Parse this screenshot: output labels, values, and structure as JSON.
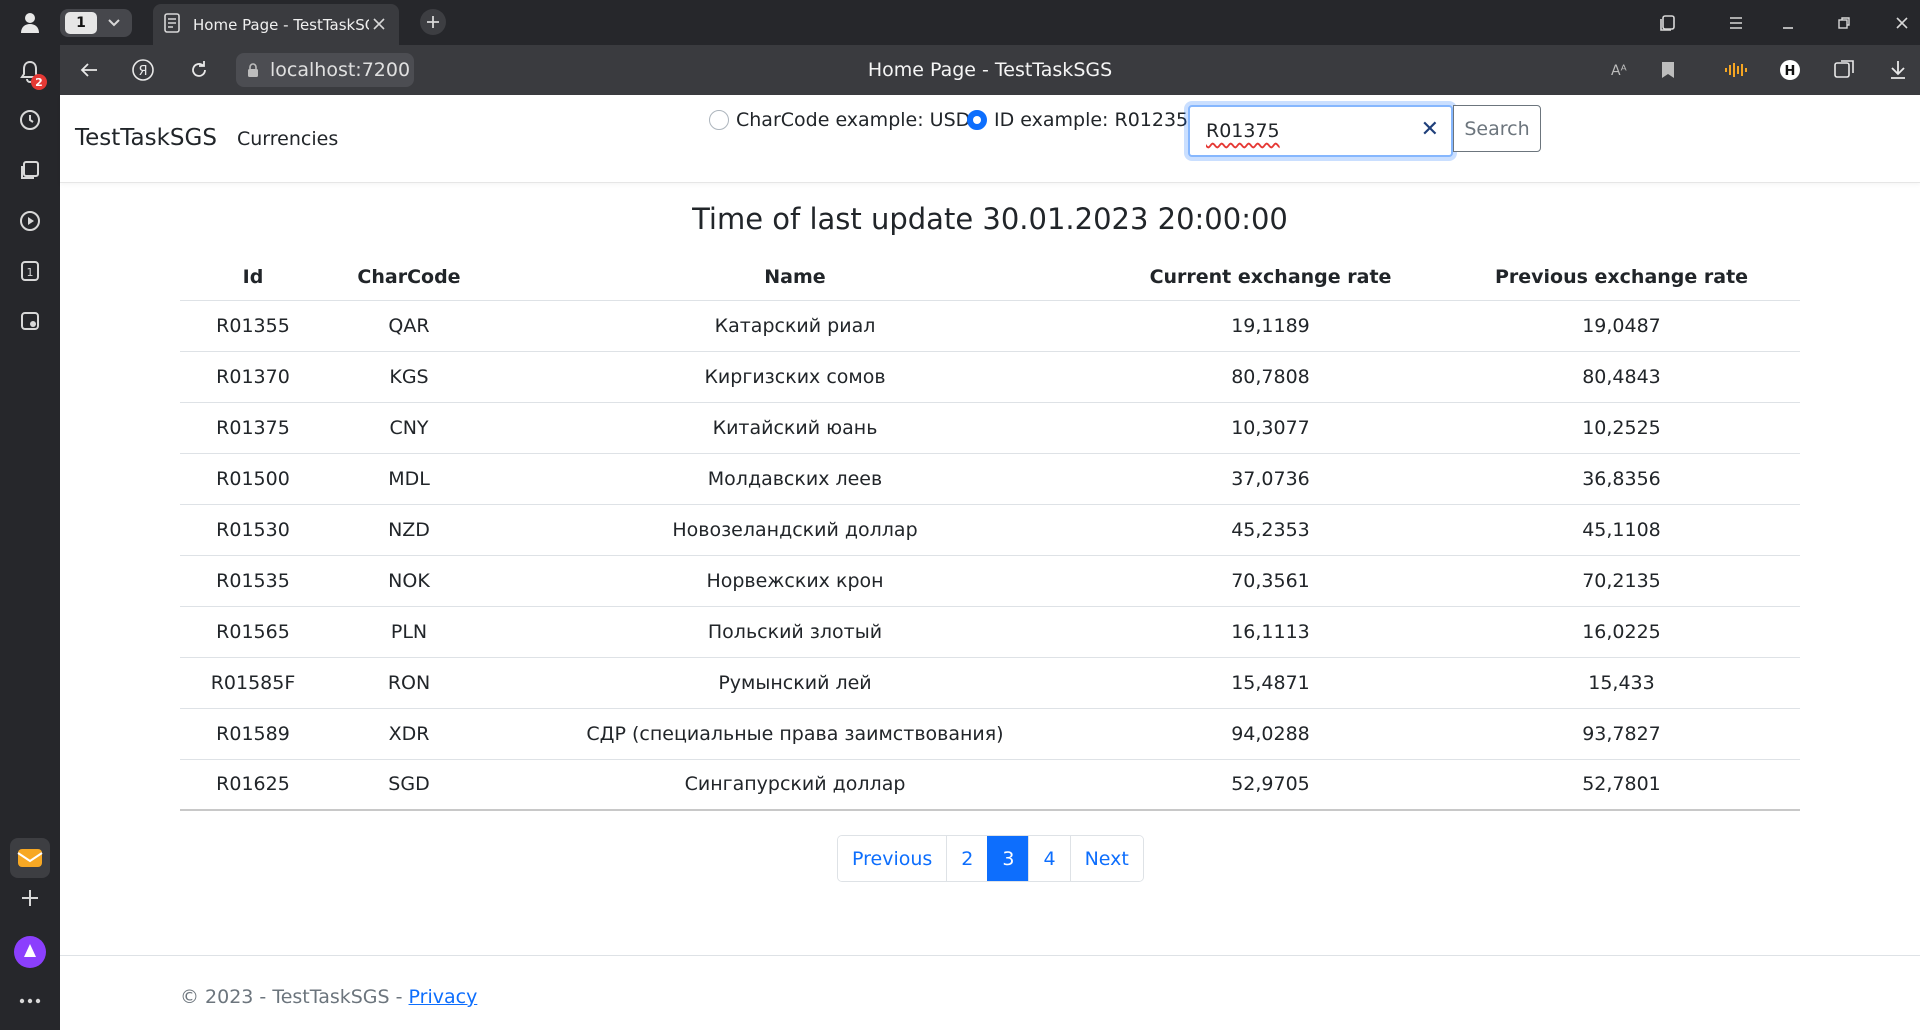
{
  "browser": {
    "tab_count": "1",
    "tab_title": "Home Page - TestTaskSGS",
    "url": "localhost:7200",
    "window_title": "Home Page - TestTaskSGS",
    "notification_badge": "2",
    "sidebar_tab_badge": "1"
  },
  "navbar": {
    "brand": "TestTaskSGS",
    "link": "Currencies",
    "radio_charcode": "CharCode example: USD",
    "radio_id": "ID example: R01235",
    "search_value": "R01375",
    "search_button": "Search"
  },
  "main": {
    "title": "Time of last update 30.01.2023 20:00:00",
    "columns": [
      "Id",
      "CharCode",
      "Name",
      "Current exchange rate",
      "Previous exchange rate"
    ],
    "rows": [
      [
        "R01355",
        "QAR",
        "Катарский риал",
        "19,1189",
        "19,0487"
      ],
      [
        "R01370",
        "KGS",
        "Киргизских сомов",
        "80,7808",
        "80,4843"
      ],
      [
        "R01375",
        "CNY",
        "Китайский юань",
        "10,3077",
        "10,2525"
      ],
      [
        "R01500",
        "MDL",
        "Молдавских леев",
        "37,0736",
        "36,8356"
      ],
      [
        "R01530",
        "NZD",
        "Новозеландский доллар",
        "45,2353",
        "45,1108"
      ],
      [
        "R01535",
        "NOK",
        "Норвежских крон",
        "70,3561",
        "70,2135"
      ],
      [
        "R01565",
        "PLN",
        "Польский злотый",
        "16,1113",
        "16,0225"
      ],
      [
        "R01585F",
        "RON",
        "Румынский лей",
        "15,4871",
        "15,433"
      ],
      [
        "R01589",
        "XDR",
        "СДР (специальные права заимствования)",
        "94,0288",
        "93,7827"
      ],
      [
        "R01625",
        "SGD",
        "Сингапурский доллар",
        "52,9705",
        "52,7801"
      ]
    ],
    "pagination": {
      "previous": "Previous",
      "pages": [
        "2",
        "3",
        "4"
      ],
      "active": "3",
      "next": "Next"
    }
  },
  "footer": {
    "text": "© 2023 - TestTaskSGS - ",
    "privacy": "Privacy"
  },
  "colors": {
    "primary": "#0d6efd",
    "chrome_dark": "#26272b",
    "chrome_bar": "#3a3b3f"
  }
}
